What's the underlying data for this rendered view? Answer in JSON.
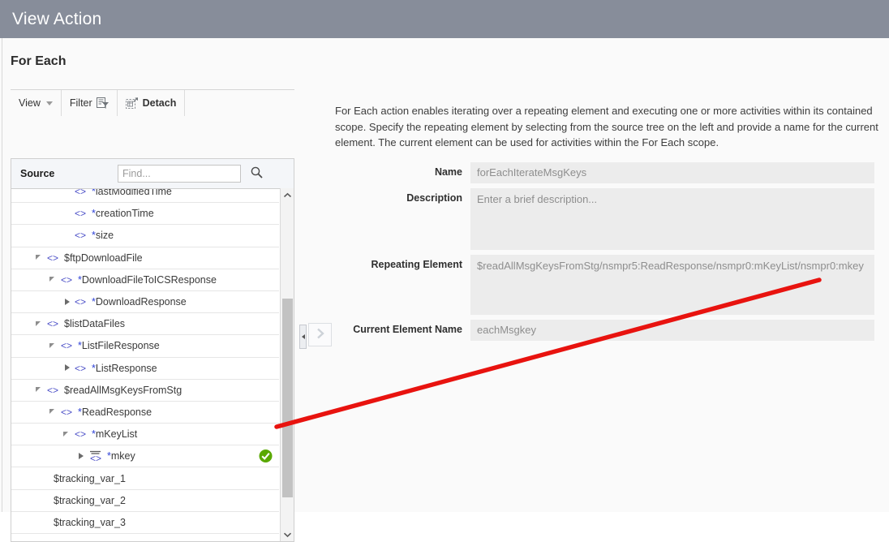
{
  "window": {
    "title": "View Action"
  },
  "page": {
    "section_title": "For Each"
  },
  "toolbar": {
    "view_label": "View",
    "filter_label": "Filter",
    "detach_label": "Detach"
  },
  "source_panel": {
    "header_label": "Source",
    "find_placeholder": "Find...",
    "find_value": "",
    "tree": [
      {
        "label": "*lastModifiedTime",
        "indent": 3,
        "twisty": "none",
        "icon": "code-brackets-icon",
        "starred": true,
        "checked": false
      },
      {
        "label": "*creationTime",
        "indent": 3,
        "twisty": "none",
        "icon": "code-brackets-icon",
        "starred": true,
        "checked": false
      },
      {
        "label": "*size",
        "indent": 3,
        "twisty": "none",
        "icon": "code-brackets-icon",
        "starred": true,
        "checked": false
      },
      {
        "label": "$ftpDownloadFile",
        "indent": 1,
        "twisty": "expanded",
        "icon": "code-brackets-icon",
        "starred": false,
        "checked": false
      },
      {
        "label": "*DownloadFileToICSResponse",
        "indent": 2,
        "twisty": "expanded",
        "icon": "code-brackets-icon",
        "starred": true,
        "checked": false
      },
      {
        "label": "*DownloadResponse",
        "indent": 3,
        "twisty": "collapsed",
        "icon": "code-brackets-icon",
        "starred": true,
        "checked": false
      },
      {
        "label": "$listDataFiles",
        "indent": 1,
        "twisty": "expanded",
        "icon": "code-brackets-icon",
        "starred": false,
        "checked": false
      },
      {
        "label": "*ListFileResponse",
        "indent": 2,
        "twisty": "expanded",
        "icon": "code-brackets-icon",
        "starred": true,
        "checked": false
      },
      {
        "label": "*ListResponse",
        "indent": 3,
        "twisty": "collapsed",
        "icon": "code-brackets-icon",
        "starred": true,
        "checked": false
      },
      {
        "label": "$readAllMsgKeysFromStg",
        "indent": 1,
        "twisty": "expanded",
        "icon": "code-brackets-icon",
        "starred": false,
        "checked": false
      },
      {
        "label": "*ReadResponse",
        "indent": 2,
        "twisty": "expanded",
        "icon": "code-brackets-icon",
        "starred": true,
        "checked": false
      },
      {
        "label": "*mKeyList",
        "indent": 3,
        "twisty": "expanded",
        "icon": "code-brackets-icon",
        "starred": true,
        "checked": false
      },
      {
        "label": "*mkey",
        "indent": 4,
        "twisty": "collapsed",
        "icon": "repeating-element-icon",
        "starred": true,
        "checked": true
      },
      {
        "label": "$tracking_var_1",
        "indent": 1,
        "twisty": "none",
        "icon": "none",
        "starred": false,
        "checked": false
      },
      {
        "label": "$tracking_var_2",
        "indent": 1,
        "twisty": "none",
        "icon": "none",
        "starred": false,
        "checked": false
      },
      {
        "label": "$tracking_var_3",
        "indent": 1,
        "twisty": "none",
        "icon": "none",
        "starred": false,
        "checked": false
      }
    ]
  },
  "detail": {
    "description_text": "For Each action enables iterating over a repeating element and executing one or more activities within its contained scope. Specify the repeating element by selecting from the source tree on the left and provide a name for the current element. The current element can be used for activities within the For Each scope.",
    "fields": {
      "name_label": "Name",
      "name_value": "forEachIterateMsgKeys",
      "description_label": "Description",
      "description_value": "",
      "description_placeholder": "Enter a brief description...",
      "repeating_element_label": "Repeating Element",
      "repeating_element_value": "$readAllMsgKeysFromStg/nsmpr5:ReadResponse/nsmpr0:mKeyList/nsmpr0:mkey",
      "current_element_label": "Current Element Name",
      "current_element_value": "eachMsgkey"
    }
  },
  "colors": {
    "header_bar": "#878d9a",
    "annotation_arrow": "#e8130f",
    "check_badge": "#59a800",
    "star_marker": "#2f43d8"
  }
}
